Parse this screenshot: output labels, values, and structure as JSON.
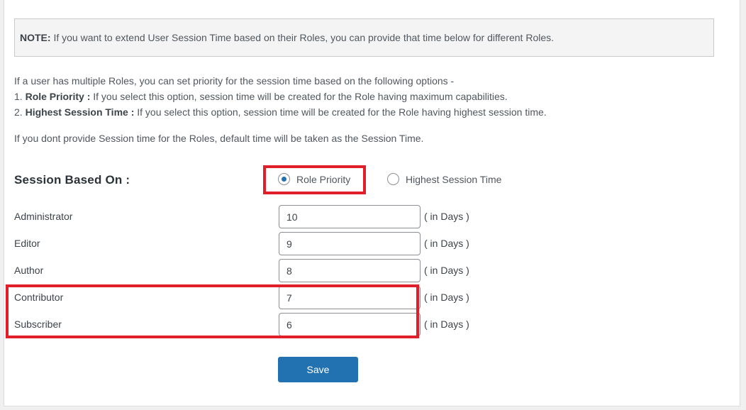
{
  "note": {
    "label": "NOTE:",
    "text": " If you want to extend User Session Time based on their Roles, you can provide that time below for different Roles."
  },
  "intro": {
    "line1": "If a user has multiple Roles, you can set priority for the session time based on the following options -",
    "option1_prefix": "1. ",
    "option1_bold": "Role Priority :",
    "option1_text": " If you select this option, session time will be created for the Role having maximum capabilities.",
    "option2_prefix": "2. ",
    "option2_bold": "Highest Session Time :",
    "option2_text": " If you select this option, session time will be created for the Role having highest session time.",
    "default_note": "If you dont provide Session time for the Roles, default time will be taken as the Session Time."
  },
  "session_based_on": {
    "label": "Session Based On :",
    "options": [
      {
        "label": "Role Priority",
        "checked": true
      },
      {
        "label": "Highest Session Time",
        "checked": false
      }
    ]
  },
  "roles": [
    {
      "name": "Administrator",
      "value": "10",
      "unit": "( in Days )"
    },
    {
      "name": "Editor",
      "value": "9",
      "unit": "( in Days )"
    },
    {
      "name": "Author",
      "value": "8",
      "unit": "( in Days )"
    },
    {
      "name": "Contributor",
      "value": "7",
      "unit": "( in Days )"
    },
    {
      "name": "Subscriber",
      "value": "6",
      "unit": "( in Days )"
    }
  ],
  "save_label": "Save",
  "colors": {
    "accent": "#2271b1",
    "highlight": "#e01f2a"
  }
}
